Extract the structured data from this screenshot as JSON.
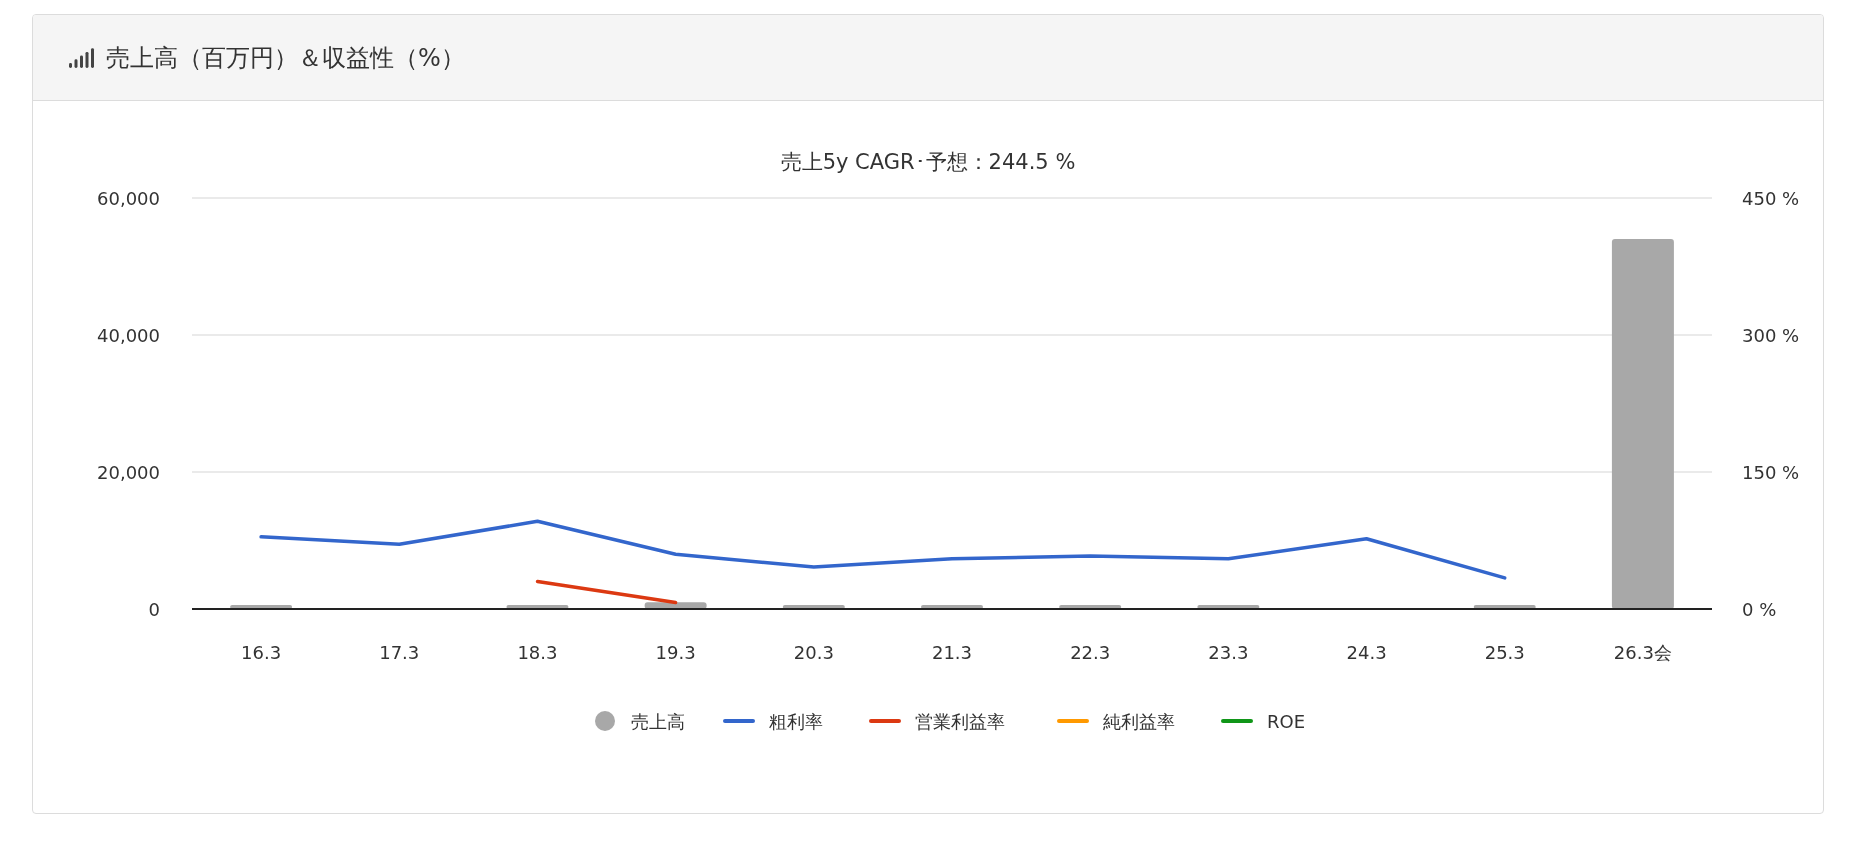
{
  "panel": {
    "title": "売上高（百万円）＆収益性（%）"
  },
  "chart_data": {
    "type": "bar",
    "title": "売上5y CAGR･予想：244.5 %",
    "legend": true,
    "categories": [
      "16.3",
      "17.3",
      "18.3",
      "19.3",
      "20.3",
      "21.3",
      "22.3",
      "23.3",
      "24.3",
      "25.3",
      "26.3会"
    ],
    "ylim": [
      0,
      60000
    ],
    "yticks": [
      {
        "value": 0,
        "label": "0"
      },
      {
        "value": 20000,
        "label": "20,000"
      },
      {
        "value": 40000,
        "label": "40,000"
      },
      {
        "value": 60000,
        "label": "60,000"
      }
    ],
    "y2lim": [
      0,
      450
    ],
    "y2ticks": [
      {
        "value": 0,
        "label": "0 %"
      },
      {
        "value": 150,
        "label": "150 %"
      },
      {
        "value": 300,
        "label": "300 %"
      },
      {
        "value": 450,
        "label": "450 %"
      }
    ],
    "series": [
      {
        "name": "売上高",
        "color": "#a8a8a8",
        "values": [
          600,
          null,
          600,
          1000,
          600,
          600,
          600,
          600,
          null,
          600,
          54000
        ]
      },
      {
        "name": "粗利率",
        "type": "line",
        "axis": "y2",
        "color": "#3366cc",
        "values": [
          79,
          71,
          96,
          60,
          46,
          55,
          58,
          55,
          77,
          34,
          null
        ]
      },
      {
        "name": "営業利益率",
        "type": "line",
        "axis": "y2",
        "color": "#dc3912",
        "values": [
          null,
          null,
          30,
          7,
          null,
          null,
          null,
          null,
          null,
          null,
          null
        ]
      },
      {
        "name": "純利益率",
        "type": "line",
        "axis": "y2",
        "color": "#ff9900",
        "values": [
          null,
          null,
          null,
          null,
          null,
          null,
          null,
          null,
          null,
          null,
          null
        ]
      },
      {
        "name": "ROE",
        "type": "line",
        "axis": "y2",
        "color": "#109618",
        "values": [
          null,
          null,
          null,
          null,
          null,
          null,
          null,
          null,
          null,
          null,
          null
        ]
      }
    ]
  }
}
